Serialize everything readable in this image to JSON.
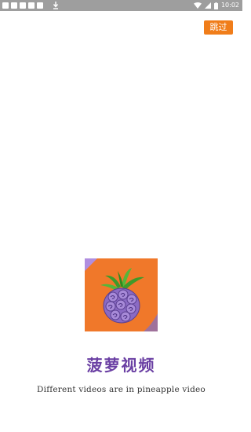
{
  "status_bar": {
    "time": "10:02",
    "icons": [
      "notification-square-icon",
      "download-icon",
      "wifi-icon",
      "cell-signal-icon",
      "battery-icon"
    ]
  },
  "splash": {
    "skip_label": "跳过",
    "app_name": "菠萝视频",
    "tagline": "Different videos are in pineapple video",
    "logo": {
      "icon": "pineapple-fruit-icon",
      "colors": {
        "background": "#f0782a",
        "corner_accent": "#b08ee0",
        "fruit": "#8a6ac4",
        "leaves": "#3f9a2a"
      }
    }
  }
}
